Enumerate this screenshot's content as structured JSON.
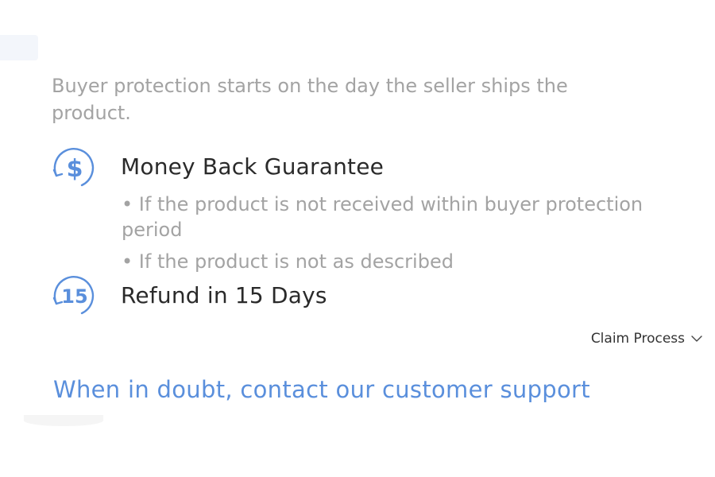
{
  "protection": {
    "intro": "Buyer protection starts on the day the seller ships the product.",
    "money_back": {
      "icon": "dollar-cycle-icon",
      "icon_glyph": "$",
      "title": "Money Back Guarantee",
      "bullets": [
        "• If the product is not received within buyer protection period",
        "• If the product is not as described"
      ]
    },
    "refund": {
      "icon": "refund-15-cycle-icon",
      "icon_glyph": "15",
      "title": "Refund in 15 Days"
    },
    "claim_process_label": "Claim Process",
    "support_link": "When in doubt, contact our customer support"
  },
  "colors": {
    "accent": "#5a8fdc",
    "icon": "#5a8fdc",
    "muted_text": "#a3a3a3",
    "title_text": "#2a2a2a"
  }
}
